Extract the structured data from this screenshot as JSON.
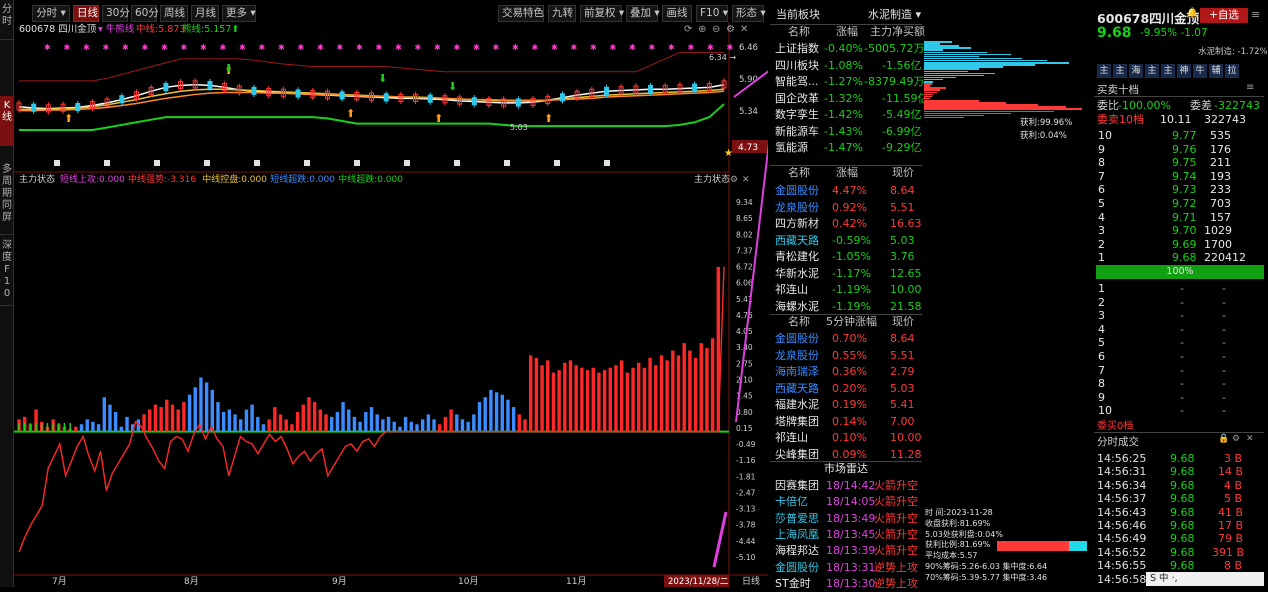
{
  "lefttabs": [
    {
      "label": "分时",
      "on": false
    },
    {
      "label": "K线",
      "on": true
    },
    {
      "label": "多周期同屏",
      "on": false
    },
    {
      "label": "深度F10",
      "on": false
    }
  ],
  "topbar": {
    "left": [
      {
        "label": "分时 ▾",
        "on": false
      },
      {
        "label": "日线",
        "on": true
      },
      {
        "label": "30分",
        "on": false
      },
      {
        "label": "60分",
        "on": false
      },
      {
        "label": "周线",
        "on": false
      },
      {
        "label": "月线",
        "on": false
      },
      {
        "label": "更多 ▾",
        "on": false
      }
    ],
    "right": [
      "交易特色 ▾",
      "九转",
      "前复权 ▾",
      "叠加 ▾",
      "画线",
      "F10 ▾",
      "形态 ▾"
    ]
  },
  "main": {
    "code": "600678 四川金顶",
    "indicator": "牛熊线",
    "mid_label": "中线:",
    "mid_value": "5.873",
    "bull_label": "熊线:",
    "bull_value": "5.157",
    "price_ticks": [
      "6.46",
      "5.90",
      "5.34"
    ],
    "price_high": "6.34",
    "price_low": "5.03",
    "price_tag": "4.73",
    "osc_title": "主力状态",
    "osc_corner": "主力状态",
    "osc_legend": [
      {
        "text": "短线上攻:0.000",
        "color": "#e040e0"
      },
      {
        "text": "中线强势:-3.316",
        "color": "#ff3838"
      },
      {
        "text": "中线控盘:0.000",
        "color": "#e6c430"
      },
      {
        "text": "短线超跌:0.000",
        "color": "#3a8cff"
      },
      {
        "text": "中线超跌:0.000",
        "color": "#18d018"
      }
    ],
    "osc_ticks": [
      "9.34",
      "8.65",
      "8.02",
      "7.37",
      "6.72",
      "6.06",
      "5.41",
      "4.76",
      "4.05",
      "3.40",
      "2.75",
      "2.10",
      "1.45",
      "0.80",
      "0.15",
      "-0.49",
      "-1.16",
      "-1.81",
      "-2.47",
      "-3.13",
      "-3.78",
      "-4.44",
      "-5.10"
    ],
    "months": [
      "7月",
      "8月",
      "9月",
      "10月",
      "11月"
    ],
    "date_tag": "2023/11/28/二",
    "period_label": "日线"
  },
  "chart_data": {
    "type": "mixed",
    "price_axis": {
      "ylim": [
        4.73,
        6.46
      ],
      "ticks": [
        6.46,
        5.9,
        5.34
      ]
    },
    "oscillator_axis": {
      "ylim": [
        -5.1,
        9.34
      ]
    },
    "high_marker": 6.34,
    "low_marker": 5.03,
    "last_tag": 4.73,
    "ma_lines": [
      {
        "color": "#ffffff",
        "values": [
          5.46,
          5.44,
          5.43,
          5.44,
          5.45,
          5.48,
          5.52,
          5.57,
          5.63,
          5.7,
          5.76,
          5.79,
          5.8,
          5.79,
          5.76,
          5.72,
          5.7,
          5.68,
          5.67,
          5.66,
          5.65,
          5.64,
          5.63,
          5.62,
          5.61,
          5.6,
          5.59,
          5.59,
          5.58,
          5.57,
          5.55,
          5.54,
          5.53,
          5.52,
          5.52,
          5.53,
          5.56,
          5.6,
          5.64,
          5.67,
          5.7,
          5.71,
          5.72,
          5.73,
          5.73,
          5.74,
          5.75,
          5.76,
          5.8
        ]
      },
      {
        "color": "#e6c430",
        "values": [
          5.42,
          5.42,
          5.42,
          5.43,
          5.44,
          5.46,
          5.49,
          5.53,
          5.57,
          5.62,
          5.66,
          5.7,
          5.72,
          5.73,
          5.73,
          5.72,
          5.71,
          5.7,
          5.69,
          5.68,
          5.67,
          5.66,
          5.65,
          5.64,
          5.63,
          5.62,
          5.61,
          5.61,
          5.6,
          5.59,
          5.58,
          5.57,
          5.56,
          5.55,
          5.55,
          5.55,
          5.56,
          5.58,
          5.6,
          5.62,
          5.64,
          5.65,
          5.66,
          5.67,
          5.68,
          5.69,
          5.7,
          5.71,
          5.73
        ]
      },
      {
        "color": "#ff8a2a",
        "values": [
          5.4,
          5.4,
          5.41,
          5.41,
          5.42,
          5.43,
          5.45,
          5.48,
          5.51,
          5.55,
          5.59,
          5.62,
          5.65,
          5.67,
          5.68,
          5.68,
          5.68,
          5.67,
          5.67,
          5.66,
          5.65,
          5.65,
          5.64,
          5.63,
          5.62,
          5.62,
          5.61,
          5.6,
          5.6,
          5.59,
          5.58,
          5.57,
          5.57,
          5.56,
          5.56,
          5.56,
          5.56,
          5.57,
          5.58,
          5.59,
          5.61,
          5.62,
          5.63,
          5.64,
          5.65,
          5.66,
          5.67,
          5.68,
          5.7
        ]
      }
    ],
    "upper_band": [
      5.86,
      5.86,
      5.86,
      5.86,
      5.86,
      5.86,
      5.9,
      5.96,
      6.02,
      6.08,
      6.14,
      6.2,
      6.2,
      6.2,
      6.2,
      6.2,
      6.18,
      6.15,
      6.12,
      6.1,
      6.08,
      6.08,
      6.08,
      6.08,
      6.08,
      6.08,
      6.06,
      6.04,
      6.02,
      6.0,
      6.0,
      6.0,
      6.0,
      6.0,
      6.0,
      6.0,
      6.0,
      6.0,
      6.0,
      6.0,
      6.0,
      6.0,
      6.0,
      6.1,
      6.2,
      6.3,
      6.3,
      6.3,
      6.3
    ],
    "support_line": [
      5.1,
      5.1,
      5.1,
      5.1,
      5.1,
      5.1,
      5.14,
      5.18,
      5.22,
      5.26,
      5.3,
      5.3,
      5.3,
      5.3,
      5.3,
      5.3,
      5.3,
      5.3,
      5.3,
      5.3,
      5.3,
      5.28,
      5.24,
      5.2,
      5.2,
      5.2,
      5.2,
      5.2,
      5.2,
      5.2,
      5.2,
      5.2,
      5.2,
      5.18,
      5.16,
      5.16,
      5.16,
      5.16,
      5.16,
      5.16,
      5.16,
      5.16,
      5.16,
      5.16,
      5.16,
      5.18,
      5.22,
      5.3,
      5.5
    ],
    "oscillator_bars": [
      0.5,
      0.6,
      0.3,
      0.9,
      0.4,
      0.2,
      0.5,
      0.3,
      0.2,
      0.1,
      0.2,
      0.3,
      0.5,
      0.4,
      0.3,
      1.4,
      1.1,
      0.8,
      0.2,
      0.6,
      0.3,
      0.5,
      0.7,
      0.9,
      1.1,
      1.0,
      1.3,
      1.1,
      0.9,
      1.2,
      1.5,
      1.8,
      2.2,
      2.0,
      1.7,
      1.2,
      0.8,
      0.9,
      0.7,
      0.5,
      0.9,
      1.1,
      0.6,
      0.3,
      0.5,
      1.0,
      0.7,
      0.5,
      0.3,
      0.8,
      1.1,
      1.4,
      1.2,
      0.9,
      0.7,
      0.6,
      0.8,
      1.2,
      0.9,
      0.6,
      0.4,
      0.8,
      1.0,
      0.7,
      0.5,
      0.6,
      0.4,
      0.2,
      0.6,
      0.4,
      0.3,
      0.5,
      0.7,
      0.5,
      0.3,
      0.6,
      0.9,
      0.7,
      0.5,
      0.4,
      0.7,
      1.2,
      1.4,
      1.7,
      1.6,
      1.5,
      1.3,
      1.0,
      0.7,
      0.5,
      3.1,
      3.0,
      2.7,
      2.9,
      2.4,
      2.5,
      2.8,
      2.9,
      2.7,
      2.6,
      2.5,
      2.6,
      2.4,
      2.5,
      2.6,
      2.7,
      2.9,
      2.4,
      2.6,
      2.8,
      2.6,
      3.0,
      2.7,
      3.1,
      2.9,
      3.3,
      3.1,
      3.6,
      3.3,
      3.0,
      3.6,
      3.4,
      3.8,
      6.7
    ],
    "oscillator_bar_colors_rule": "blue when short-term oversold (index<90 and alternating), red otherwise",
    "oscillator_line": [
      -4.9,
      -4.3,
      -3.8,
      -3.4,
      -3.0,
      -1.5,
      -1.0,
      -0.5,
      -1.8,
      -1.2,
      -0.6,
      -0.2,
      -1.0,
      -1.6,
      -0.8,
      -2.4,
      -1.7,
      -1.3,
      -0.9,
      -0.5,
      0.4,
      0.2,
      -0.3,
      -0.7,
      -1.2,
      -1.5,
      -0.4,
      -0.2,
      -0.3,
      -0.8,
      -0.1,
      0.3,
      -0.3,
      0.2,
      -0.3,
      -0.6,
      -1.8,
      -1.0,
      -0.2,
      -0.4,
      -0.5,
      -0.9,
      -0.5,
      -0.1,
      -0.4,
      -0.2,
      -0.7,
      -1.3,
      -1.0,
      -0.8,
      -1.2,
      -0.9,
      -0.7,
      -1.8,
      -1.4,
      -1.0,
      -0.6,
      -0.5,
      -0.8,
      -0.4,
      -0.3,
      -0.6,
      -0.2,
      0.0,
      0.0,
      0.0,
      0.0,
      0.0,
      0.0,
      0.0,
      0.0,
      0.0,
      0.0,
      0.0,
      0.0,
      0.0,
      0.0,
      0.0,
      0.0,
      0.0,
      0.0,
      0.0,
      0.0,
      0.0,
      0.0,
      0.0,
      0.0,
      0.0,
      0.0,
      0.0,
      0.0,
      0.0,
      0.0,
      0.0,
      0.0,
      0.0,
      0.0,
      0.0,
      0.0,
      0.0,
      0.0,
      0.0,
      0.0,
      0.0,
      0.0,
      0.0,
      0.0,
      0.0,
      0.0,
      0.0,
      0.0,
      0.0,
      0.0,
      0.0,
      0.0,
      0.0,
      0.0,
      0.0,
      0.0,
      0.0,
      0.0,
      6.7
    ]
  },
  "sectors": {
    "title": "当前板块",
    "title_right": "水泥制造 ▾",
    "headers": [
      "名称",
      "涨幅",
      "主力净买额"
    ],
    "rows": [
      {
        "name": "上证指数",
        "pct": "-0.40%",
        "amt": "-5005.72万"
      },
      {
        "name": "四川板块",
        "pct": "-1.08%",
        "amt": "-1.56亿"
      },
      {
        "name": "智能驾...",
        "pct": "-1.27%",
        "amt": "-8379.49万"
      },
      {
        "name": "国企改革",
        "pct": "-1.32%",
        "amt": "-11.59亿"
      },
      {
        "name": "数字孪生",
        "pct": "-1.42%",
        "amt": "-5.49亿"
      },
      {
        "name": "新能源车",
        "pct": "-1.43%",
        "amt": "-6.99亿"
      },
      {
        "name": "氢能源",
        "pct": "-1.47%",
        "amt": "-9.29亿"
      }
    ],
    "list1_headers": [
      "名称",
      "涨幅",
      "现价"
    ],
    "list1": [
      {
        "name": "金圆股份",
        "pct": "4.47%",
        "price": "8.64",
        "up": true
      },
      {
        "name": "龙泉股份",
        "pct": "0.92%",
        "price": "5.51",
        "up": true
      },
      {
        "name": "四方新材",
        "pct": "0.42%",
        "price": "16.63",
        "up": true
      },
      {
        "name": "西藏天路",
        "pct": "-0.59%",
        "price": "5.03",
        "up": false
      },
      {
        "name": "青松建化",
        "pct": "-1.05%",
        "price": "3.76",
        "up": false
      },
      {
        "name": "华新水泥",
        "pct": "-1.17%",
        "price": "12.65",
        "up": false
      },
      {
        "name": "祁连山",
        "pct": "-1.19%",
        "price": "10.00",
        "up": false
      },
      {
        "name": "海螺水泥",
        "pct": "-1.19%",
        "price": "21.58",
        "up": false
      }
    ],
    "list2_headers": [
      "名称",
      "5分钟涨幅",
      "现价"
    ],
    "list2": [
      {
        "name": "金圆股份",
        "pct": "0.70%",
        "price": "8.64"
      },
      {
        "name": "龙泉股份",
        "pct": "0.55%",
        "price": "5.51"
      },
      {
        "name": "海南瑞泽",
        "pct": "0.36%",
        "price": "2.79"
      },
      {
        "name": "西藏天路",
        "pct": "0.20%",
        "price": "5.03"
      },
      {
        "name": "福建水泥",
        "pct": "0.19%",
        "price": "5.41"
      },
      {
        "name": "塔牌集团",
        "pct": "0.14%",
        "price": "7.00"
      },
      {
        "name": "祁连山",
        "pct": "0.10%",
        "price": "10.00"
      },
      {
        "name": "尖峰集团",
        "pct": "0.09%",
        "price": "11.28"
      }
    ],
    "radar_title": "市场雷达",
    "radar": [
      {
        "name": "因赛集团",
        "time": "18/14:42",
        "event": "火箭升空"
      },
      {
        "name": "卡倍亿",
        "time": "18/14:05",
        "event": "火箭升空"
      },
      {
        "name": "莎普爱思",
        "time": "18/13:49",
        "event": "火箭升空"
      },
      {
        "name": "上海凤凰",
        "time": "18/13:45",
        "event": "火箭升空"
      },
      {
        "name": "海程邦达",
        "time": "18/13:39",
        "event": "火箭升空"
      },
      {
        "name": "金圆股份",
        "time": "18/13:31",
        "event": "逆势上攻"
      },
      {
        "name": "ST金时",
        "time": "18/13:30",
        "event": "逆势上攻"
      }
    ]
  },
  "depth": {
    "profit_label": "获利:99.96%",
    "profit2_label": "获利:0.04%",
    "info": [
      "时    间:2023-11-28",
      "收盘获利:81.69%",
      "5.03处获利盘:0.04%",
      "获利比例:81.69%",
      "平均成本:5.57",
      "90%筹码:5.26-6.03  集中度:6.64",
      "70%筹码:5.39-5.77  集中度:3.46"
    ],
    "bars": [
      0.18,
      0.1,
      0.22,
      0.3,
      0.12,
      0.4,
      0.55,
      0.35,
      0.62,
      0.78,
      0.92,
      0.7,
      0.5,
      0.35,
      0.28,
      0.45,
      0.38,
      0.2,
      0.12,
      0.06,
      0.05,
      0.04,
      0.14,
      0.1,
      0.08,
      0.06,
      0.05,
      0.04,
      0.35,
      0.52,
      0.72,
      0.9,
      1.0,
      0.82,
      0.55,
      0.38,
      0.25
    ]
  },
  "quote": {
    "code": "600678",
    "name": "四川金顶",
    "add": "+自选",
    "price": "9.68",
    "pct": "-9.95%",
    "chg": "-1.07",
    "industry": "水泥制造: -1.72%",
    "tags": [
      "主",
      "主",
      "海",
      "主",
      "主",
      "神",
      "牛",
      "辅",
      "拉"
    ],
    "book_title": "买卖十档",
    "weibi_label": "委比",
    "weibi": "-100.00%",
    "weicha_label": "委差",
    "weicha": "-322743",
    "sell_label": "委卖10档",
    "sell_price": "10.11",
    "sell_vol": "322743",
    "bids": [
      {
        "lvl": "10",
        "price": "9.77",
        "vol": "535"
      },
      {
        "lvl": "9",
        "price": "9.76",
        "vol": "176"
      },
      {
        "lvl": "8",
        "price": "9.75",
        "vol": "211"
      },
      {
        "lvl": "7",
        "price": "9.74",
        "vol": "193"
      },
      {
        "lvl": "6",
        "price": "9.73",
        "vol": "233"
      },
      {
        "lvl": "5",
        "price": "9.72",
        "vol": "703"
      },
      {
        "lvl": "4",
        "price": "9.71",
        "vol": "157"
      },
      {
        "lvl": "3",
        "price": "9.70",
        "vol": "1029"
      },
      {
        "lvl": "2",
        "price": "9.69",
        "vol": "1700"
      },
      {
        "lvl": "1",
        "price": "9.68",
        "vol": "220412"
      }
    ],
    "bar_label": "100%",
    "asks": [
      {
        "lvl": "1",
        "price": "-",
        "vol": "-"
      },
      {
        "lvl": "2",
        "price": "-",
        "vol": "-"
      },
      {
        "lvl": "3",
        "price": "-",
        "vol": "-"
      },
      {
        "lvl": "4",
        "price": "-",
        "vol": "-"
      },
      {
        "lvl": "5",
        "price": "-",
        "vol": "-"
      },
      {
        "lvl": "6",
        "price": "-",
        "vol": "-"
      },
      {
        "lvl": "7",
        "price": "-",
        "vol": "-"
      },
      {
        "lvl": "8",
        "price": "-",
        "vol": "-"
      },
      {
        "lvl": "9",
        "price": "-",
        "vol": "-"
      },
      {
        "lvl": "10",
        "price": "-",
        "vol": "-"
      }
    ],
    "buy_label": "委买0档",
    "ticks_title": "分时成交",
    "ticks": [
      {
        "t": "14:56:25",
        "p": "9.68",
        "v": "3 B"
      },
      {
        "t": "14:56:31",
        "p": "9.68",
        "v": "14 B"
      },
      {
        "t": "14:56:34",
        "p": "9.68",
        "v": "4 B"
      },
      {
        "t": "14:56:37",
        "p": "9.68",
        "v": "5 B"
      },
      {
        "t": "14:56:43",
        "p": "9.68",
        "v": "41 B"
      },
      {
        "t": "14:56:46",
        "p": "9.68",
        "v": "17 B"
      },
      {
        "t": "14:56:49",
        "p": "9.68",
        "v": "79 B"
      },
      {
        "t": "14:56:52",
        "p": "9.68",
        "v": "391 B"
      },
      {
        "t": "14:56:55",
        "p": "9.68",
        "v": "8 B"
      },
      {
        "t": "14:56:58",
        "p": "",
        "v": ""
      }
    ],
    "ime": "中 ·,"
  }
}
